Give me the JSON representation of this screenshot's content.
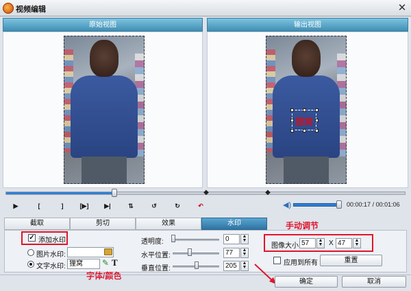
{
  "window": {
    "title": "视频编辑",
    "close_glyph": "✕"
  },
  "panes": {
    "original_label": "原始视图",
    "output_label": "输出视图"
  },
  "watermark": {
    "preview_text": "狸窝"
  },
  "controls": {
    "play": "▶",
    "mark_in": "[",
    "mark_out": "]",
    "segment": "[▶]",
    "skip_end": "▶|",
    "flip_v": "⇅",
    "rotate_left": "↺",
    "rotate_right": "↻",
    "undo": "↶",
    "time_current": "00:00:17",
    "time_total": "00:01:06",
    "time_separator": "/",
    "progress": 0.27,
    "volume": 0.95
  },
  "tabs": [
    {
      "label": "截取"
    },
    {
      "label": "剪切"
    },
    {
      "label": "效果"
    },
    {
      "label": "水印"
    }
  ],
  "watermark_panel": {
    "add_label": "添加水印",
    "image_label": "图片水印:",
    "text_label": "文字水印:",
    "text_value": "狸窝",
    "opacity_label": "透明度:",
    "opacity_value": "0",
    "hpos_label": "水平位置:",
    "hpos_value": "77",
    "vpos_label": "垂直位置:",
    "vpos_value": "205",
    "size_label": "图像大小:",
    "width_value": "57",
    "x_sep": "X",
    "height_value": "47",
    "apply_all_label": "应用到所有",
    "reset_label": "重置"
  },
  "annotations": {
    "manual": "手动调节",
    "font_color": "字体/颜色"
  },
  "footer": {
    "ok_label": "确定",
    "cancel_label": "取消"
  }
}
